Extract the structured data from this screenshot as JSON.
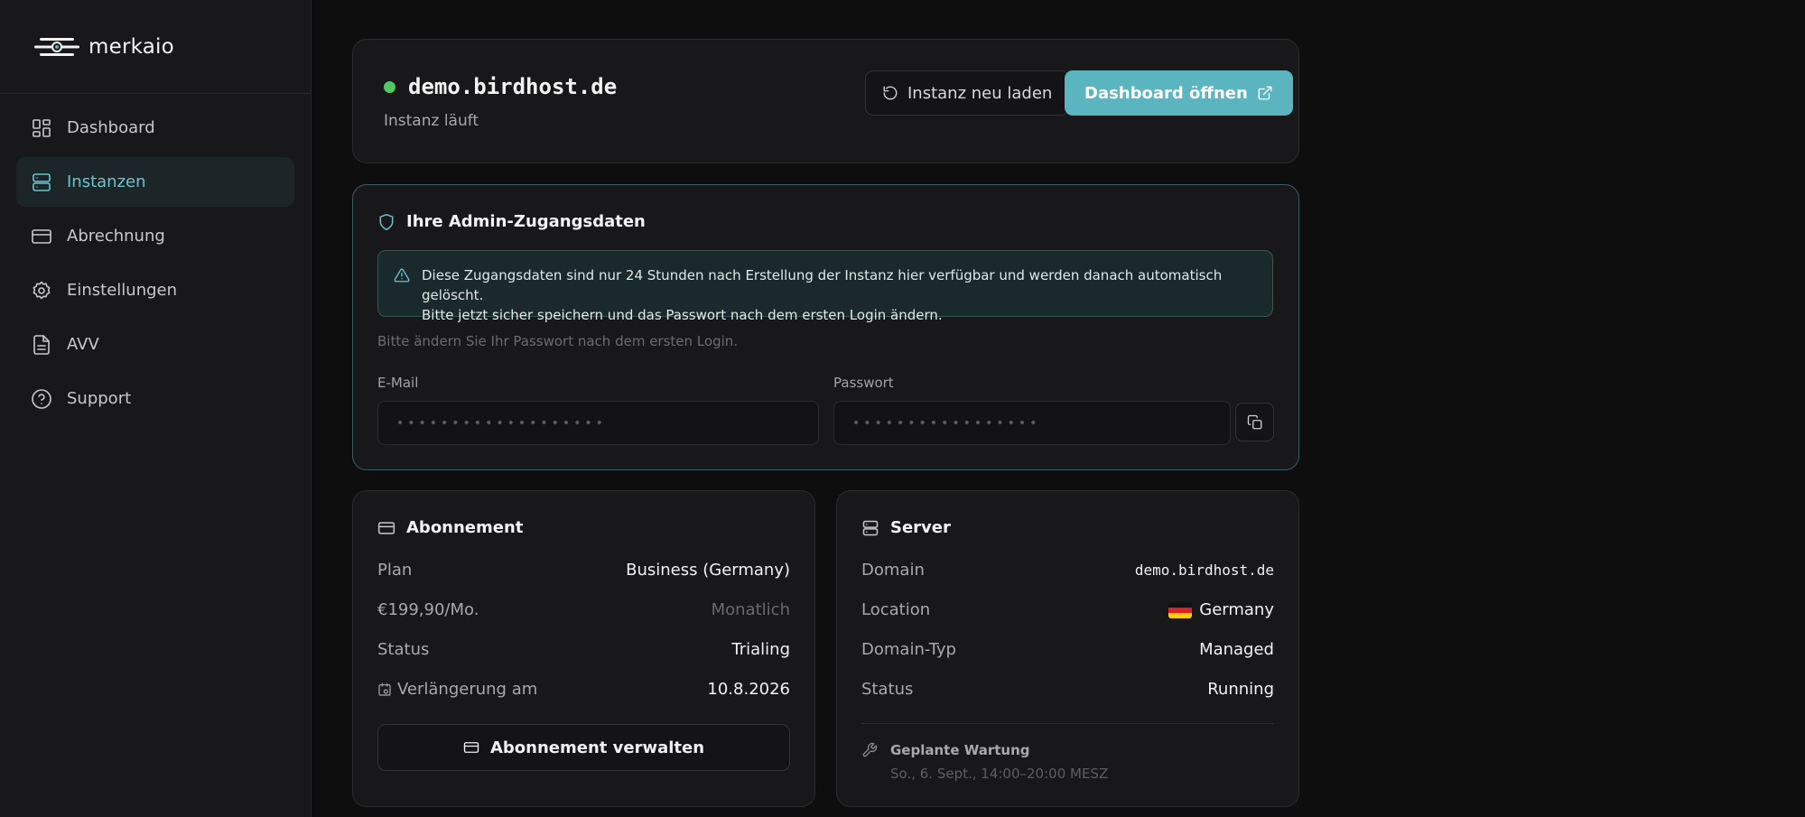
{
  "brand": {
    "name": "merkaio"
  },
  "sidebar": {
    "items": [
      {
        "label": "Dashboard",
        "icon": "dashboard-icon"
      },
      {
        "label": "Instanzen",
        "icon": "server-icon",
        "active": true
      },
      {
        "label": "Abrechnung",
        "icon": "credit-card-icon"
      },
      {
        "label": "Einstellungen",
        "icon": "gear-icon"
      },
      {
        "label": "AVV",
        "icon": "document-icon"
      },
      {
        "label": "Support",
        "icon": "help-circle-icon"
      }
    ]
  },
  "instance": {
    "host": "demo.birdhost.de",
    "status_text": "Instanz läuft",
    "status_color": "#4ccb64",
    "reload_label": "Instanz neu laden",
    "open_label": "Dashboard öffnen"
  },
  "credentials": {
    "title": "Ihre Admin-Zugangsdaten",
    "alert_line1": "Diese Zugangsdaten sind nur 24 Stunden nach Erstellung der Instanz hier verfügbar und werden danach automatisch gelöscht.",
    "alert_line2": "Bitte jetzt sicher speichern und das Passwort nach dem ersten Login ändern.",
    "hint": "Bitte ändern Sie Ihr Passwort nach dem ersten Login.",
    "email_label": "E-Mail",
    "email_value": "•••••••••••••••••••",
    "password_label": "Passwort",
    "password_value": "•••••••••••••••••"
  },
  "subscription": {
    "title": "Abonnement",
    "plan_key": "Plan",
    "plan_value": "Business (Germany)",
    "price": "€199,90/Mo.",
    "interval": "Monatlich",
    "status_key": "Status",
    "status_value": "Trialing",
    "renewal_key": "Verlängerung am",
    "renewal_value": "10.8.2026",
    "manage_label": "Abonnement verwalten"
  },
  "server": {
    "title": "Server",
    "domain_key": "Domain",
    "domain_value": "demo.birdhost.de",
    "location_key": "Location",
    "location_value": "Germany",
    "domain_type_key": "Domain-Typ",
    "domain_type_value": "Managed",
    "status_key": "Status",
    "status_value": "Running",
    "maintenance_title": "Geplante Wartung",
    "maintenance_time": "So., 6. Sept., 14:00–20:00 MESZ"
  },
  "colors": {
    "accent": "#5ab5c1",
    "active_nav": "#6cc3cc",
    "online": "#4ccb64"
  }
}
